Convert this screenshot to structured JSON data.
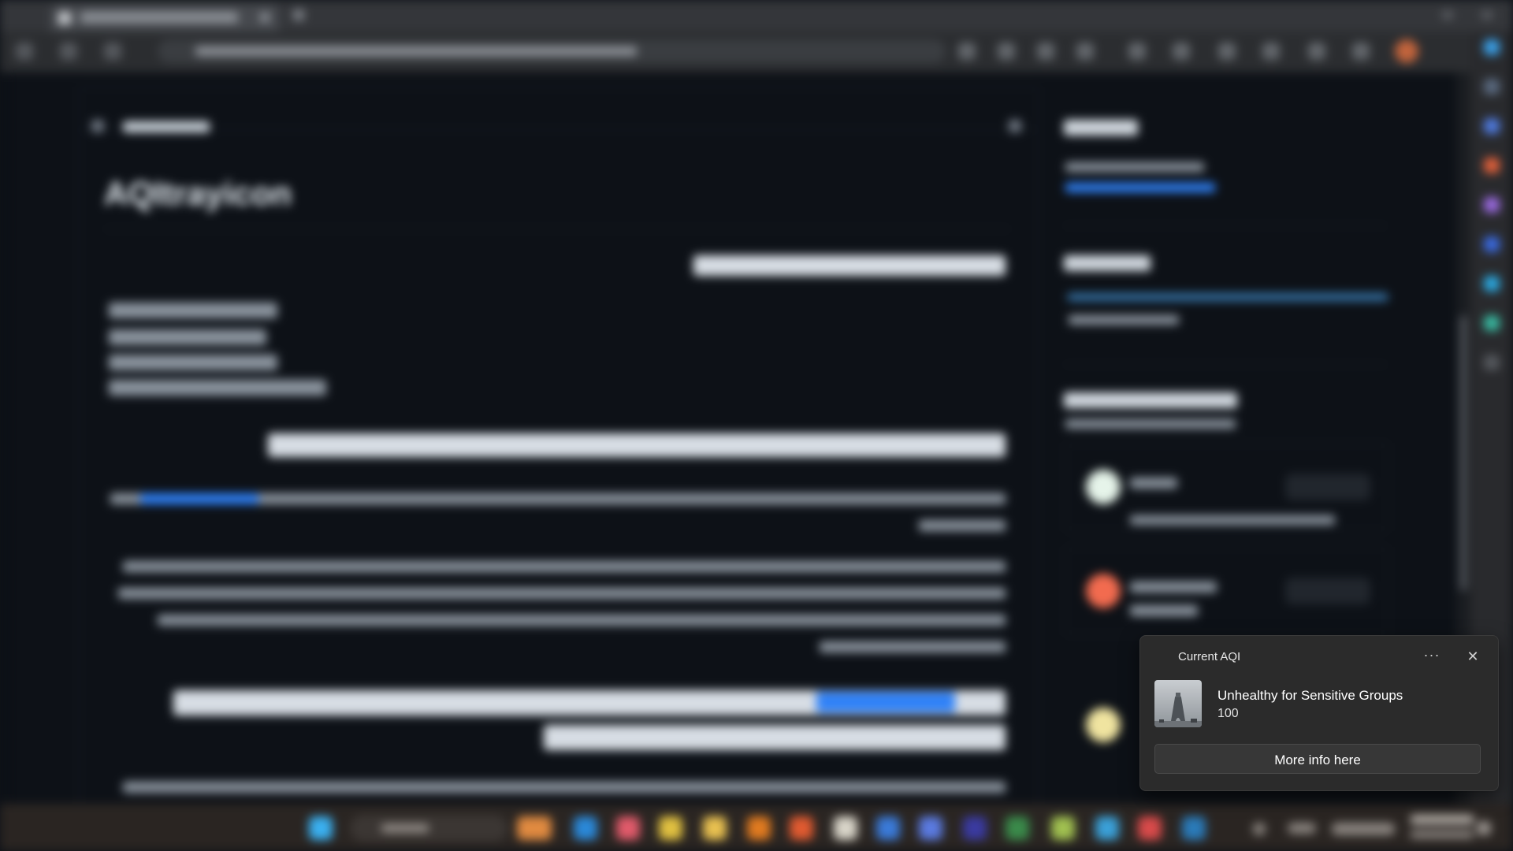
{
  "background": {
    "repo_title": "AQItrayicon"
  },
  "notification": {
    "app_name": "Current AQI",
    "more_label": "···",
    "close_label": "✕",
    "title": "Unhealthy for Sensitive Groups",
    "value": "100",
    "button_label": "More info here",
    "thumbnail_icon": "azadi-tower-smog-photo"
  },
  "colors": {
    "toast_bg": "#2b2b2b",
    "page_bg": "#0d1117",
    "link": "#2f81f7"
  }
}
